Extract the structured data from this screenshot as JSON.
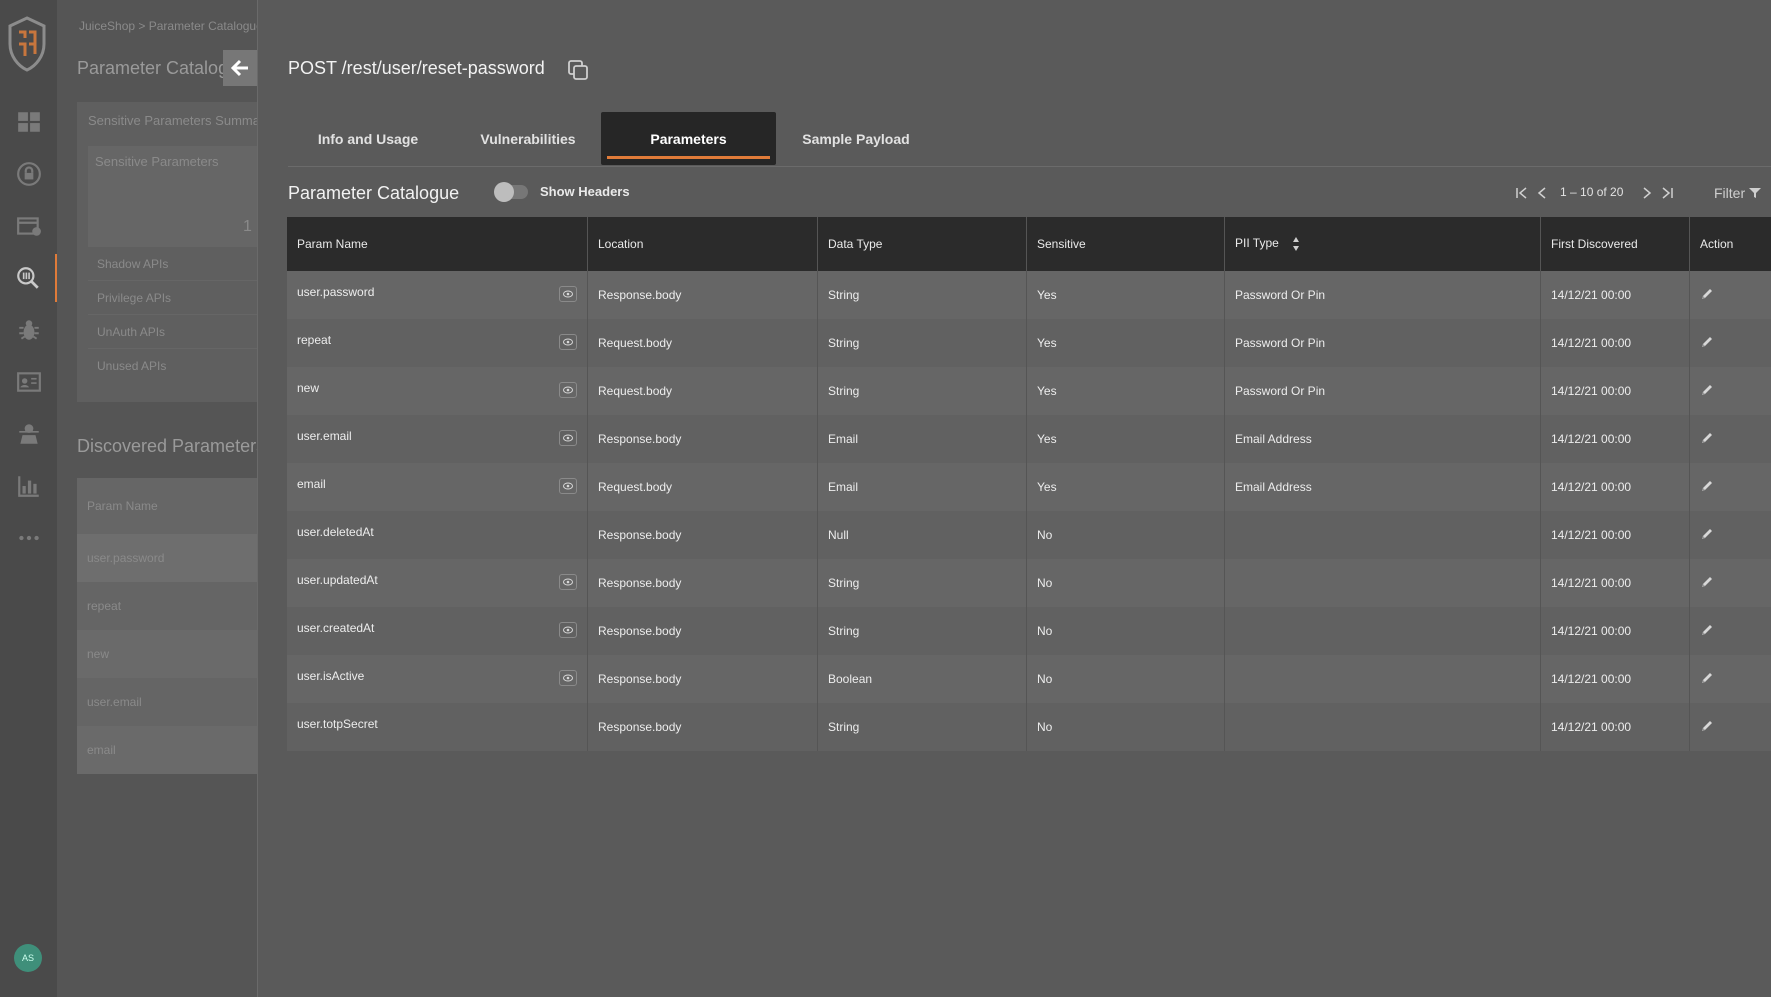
{
  "nav": {
    "items": [
      "dashboard-icon",
      "lock-icon",
      "api-card-icon",
      "param-search-icon",
      "bug-icon",
      "contact-card-icon",
      "agent-icon",
      "bar-chart-icon",
      "more-icon"
    ],
    "avatar_initials": "AS"
  },
  "background": {
    "breadcrumb": "JuiceShop > Parameter Catalogue",
    "title": "Parameter Catalogue",
    "summary_title": "Sensitive Parameters Summary",
    "sensitive_label": "Sensitive Parameters",
    "sensitive_value": "1",
    "summary_items": [
      "Shadow APIs",
      "Privilege APIs",
      "UnAuth APIs",
      "Unused APIs"
    ],
    "discovered_title": "Discovered Parameters",
    "discovered_header": "Param Name",
    "discovered_rows": [
      "user.password",
      "repeat",
      "new",
      "user.email",
      "email"
    ]
  },
  "panel": {
    "endpoint": "POST /rest/user/reset-password",
    "tabs": [
      {
        "label": "Info and Usage"
      },
      {
        "label": "Vulnerabilities"
      },
      {
        "label": "Parameters"
      },
      {
        "label": "Sample Payload"
      }
    ],
    "section_title": "Parameter Catalogue",
    "toggle_label": "Show Headers",
    "pager_text": "1 – 10 of 20",
    "filter_label": "Filter"
  },
  "table": {
    "headers": [
      "Param Name",
      "Location",
      "Data Type",
      "Sensitive",
      "PII Type",
      "First Discovered",
      "Action"
    ],
    "rows": [
      {
        "name": "user.password",
        "eye": true,
        "location": "Response.body",
        "type": "String",
        "sensitive": "Yes",
        "pii": "Password Or Pin",
        "first": "14/12/21 00:00"
      },
      {
        "name": "repeat",
        "eye": true,
        "location": "Request.body",
        "type": "String",
        "sensitive": "Yes",
        "pii": "Password Or Pin",
        "first": "14/12/21 00:00"
      },
      {
        "name": "new",
        "eye": true,
        "location": "Request.body",
        "type": "String",
        "sensitive": "Yes",
        "pii": "Password Or Pin",
        "first": "14/12/21 00:00"
      },
      {
        "name": "user.email",
        "eye": true,
        "location": "Response.body",
        "type": "Email",
        "sensitive": "Yes",
        "pii": "Email Address",
        "first": "14/12/21 00:00"
      },
      {
        "name": "email",
        "eye": true,
        "location": "Request.body",
        "type": "Email",
        "sensitive": "Yes",
        "pii": "Email Address",
        "first": "14/12/21 00:00"
      },
      {
        "name": "user.deletedAt",
        "eye": false,
        "location": "Response.body",
        "type": "Null",
        "sensitive": "No",
        "pii": "",
        "first": "14/12/21 00:00"
      },
      {
        "name": "user.updatedAt",
        "eye": true,
        "location": "Response.body",
        "type": "String",
        "sensitive": "No",
        "pii": "",
        "first": "14/12/21 00:00"
      },
      {
        "name": "user.createdAt",
        "eye": true,
        "location": "Response.body",
        "type": "String",
        "sensitive": "No",
        "pii": "",
        "first": "14/12/21 00:00"
      },
      {
        "name": "user.isActive",
        "eye": true,
        "location": "Response.body",
        "type": "Boolean",
        "sensitive": "No",
        "pii": "",
        "first": "14/12/21 00:00"
      },
      {
        "name": "user.totpSecret",
        "eye": false,
        "location": "Response.body",
        "type": "String",
        "sensitive": "No",
        "pii": "",
        "first": "14/12/21 00:00"
      }
    ]
  },
  "colors": {
    "accent": "#e07b39",
    "header_bg": "#2b2b2b",
    "active_tab_bg": "#262626"
  }
}
